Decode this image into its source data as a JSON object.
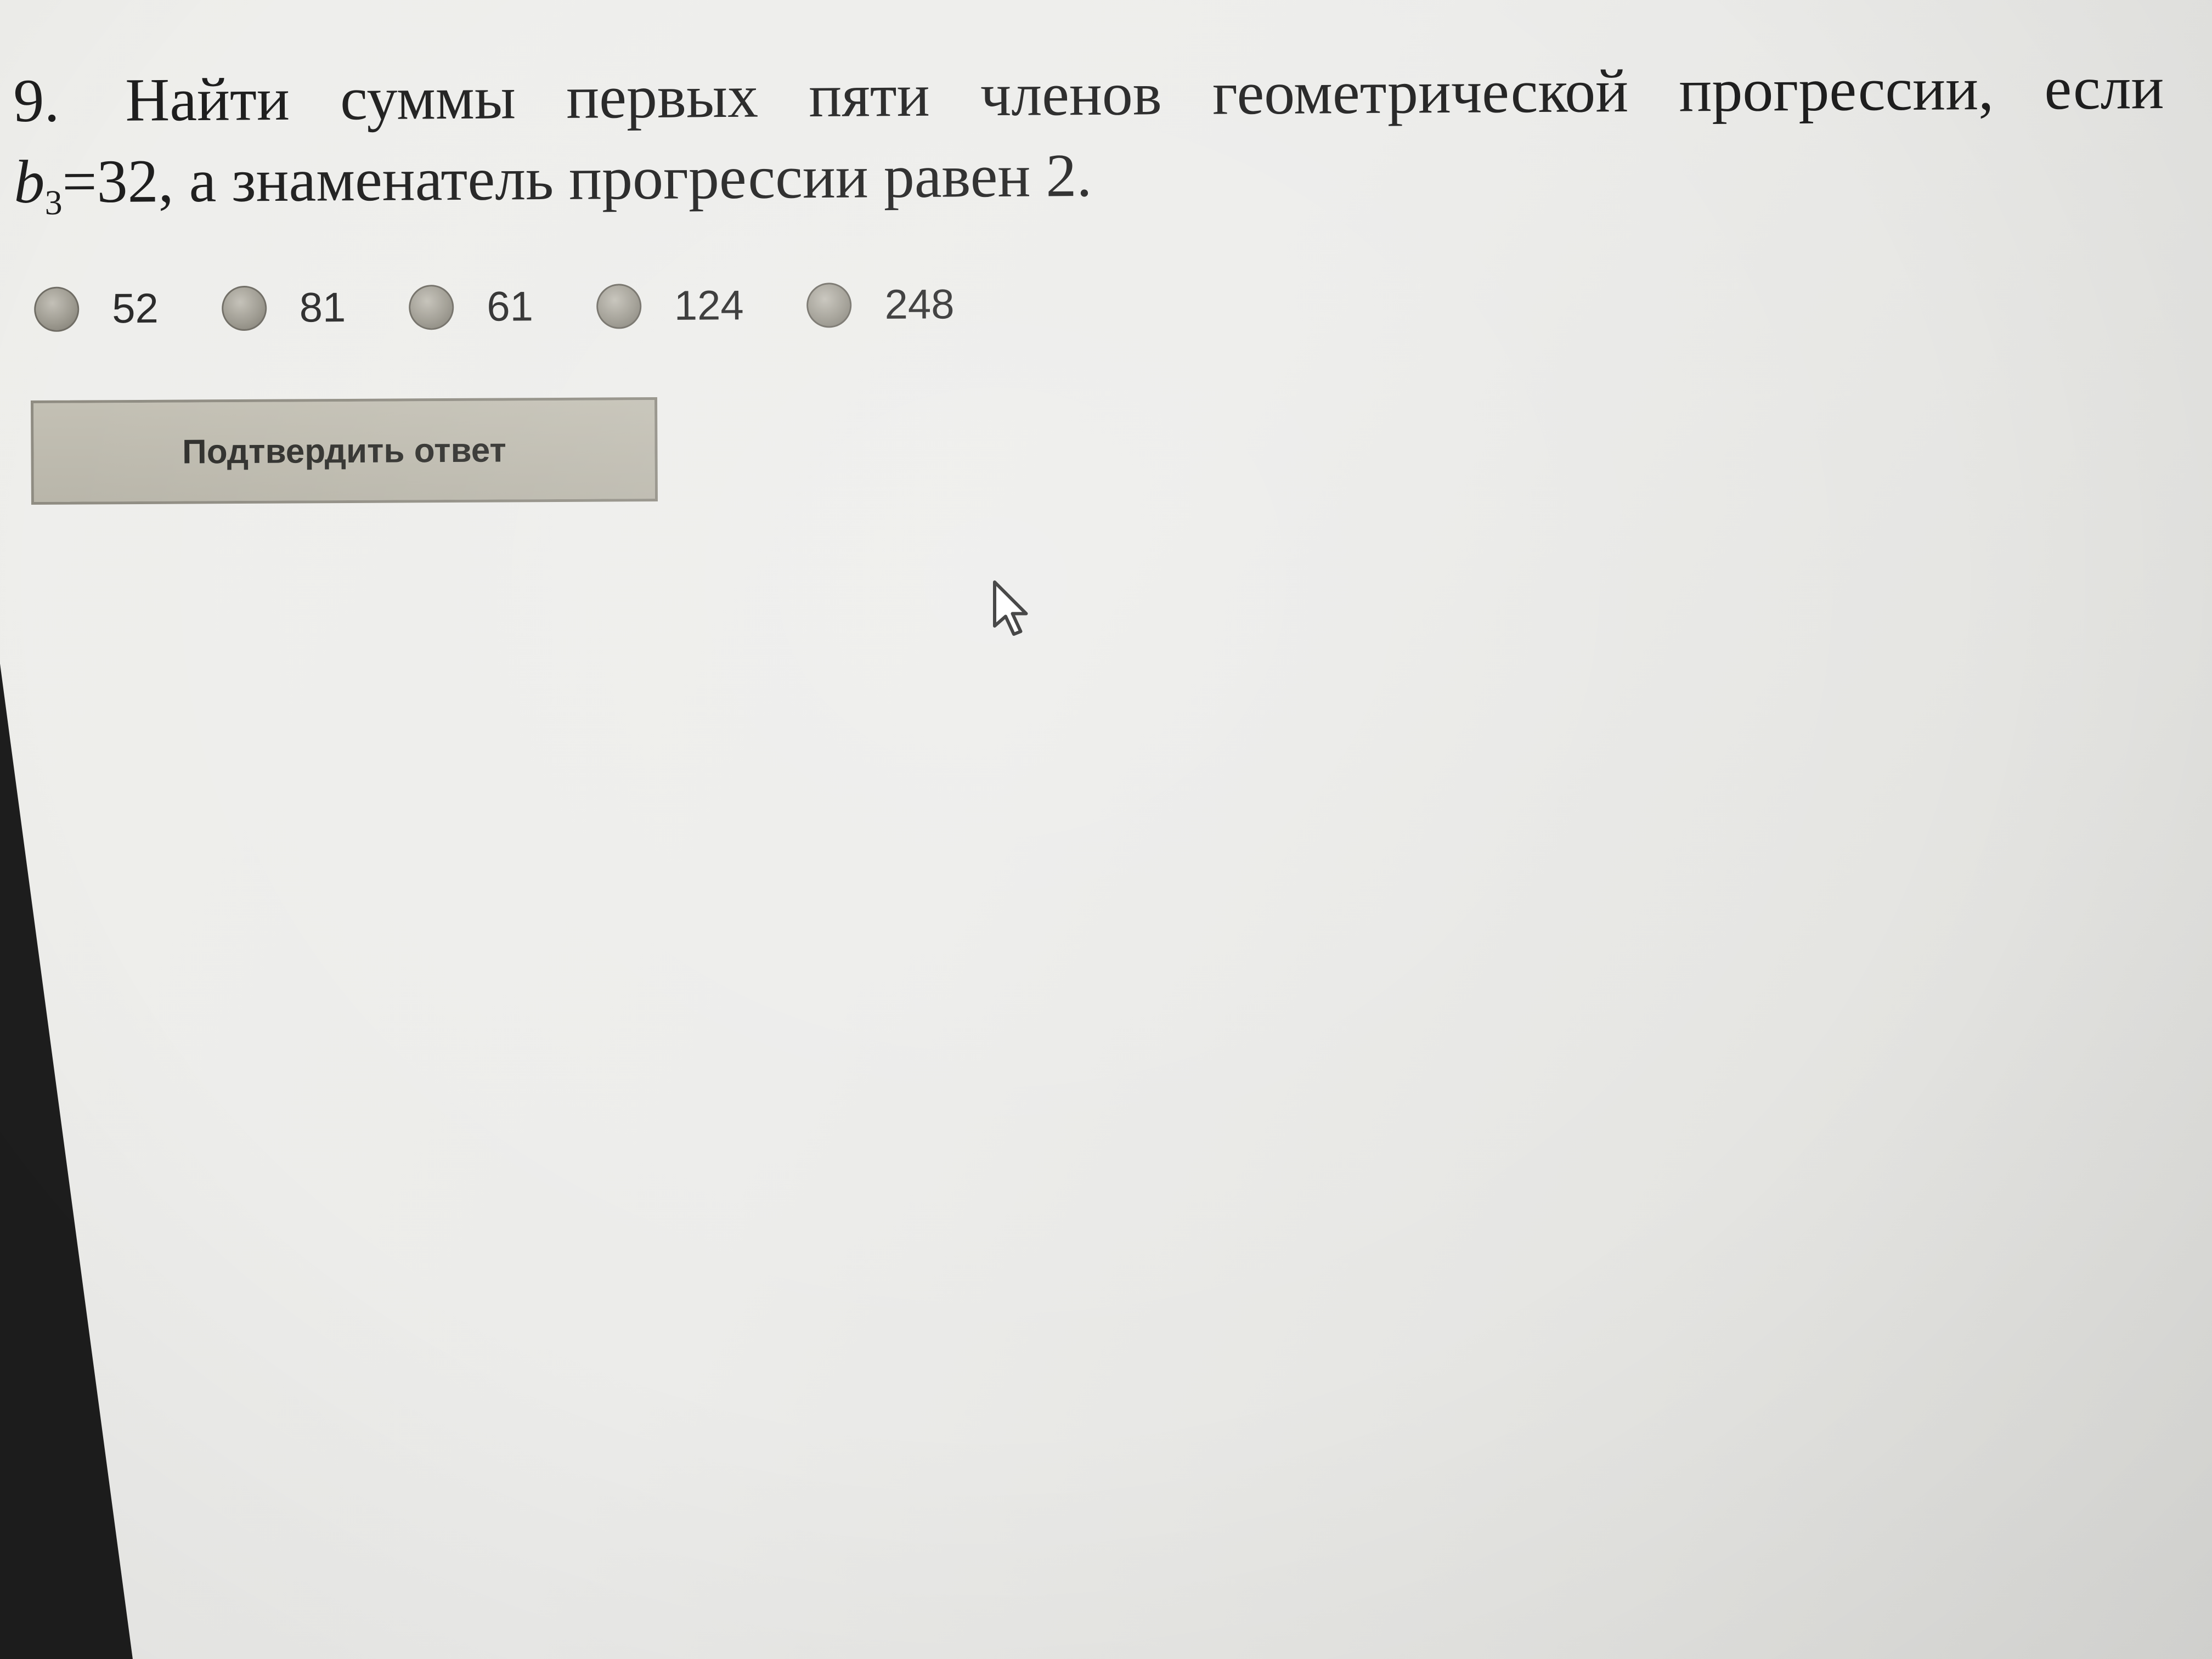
{
  "question": {
    "number": "9.",
    "line1_text": "Найти суммы первых пяти членов геометрической прогрессии, если",
    "var_b": "b",
    "var_sub": "3",
    "equals_value": "=32",
    "line2_rest": ", а знаменатель прогрессии равен 2."
  },
  "options": [
    {
      "label": "52"
    },
    {
      "label": "81"
    },
    {
      "label": "61"
    },
    {
      "label": "124"
    },
    {
      "label": "248"
    }
  ],
  "submit": {
    "label": "Подтвердить ответ"
  },
  "colors": {
    "button_bg": "#bdbaae",
    "radio_fill": "#9e9b91",
    "text": "#1e1e1e"
  }
}
